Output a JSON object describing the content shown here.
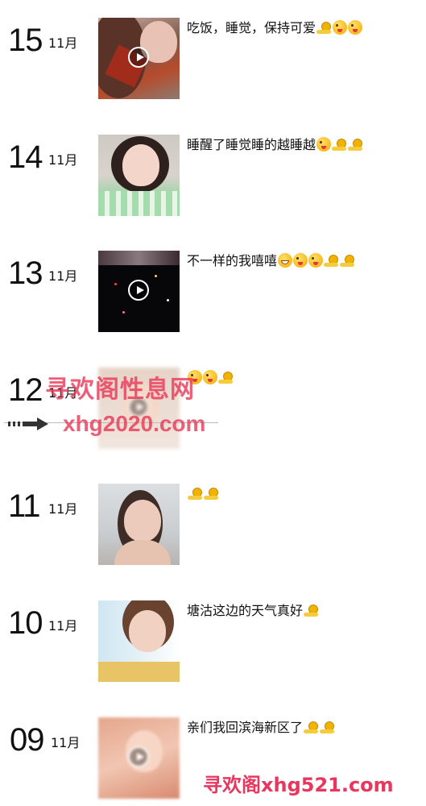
{
  "entries": [
    {
      "day": "15",
      "month": "11月",
      "caption": "吃饭，睡觉，保持可爱",
      "emojis": [
        "snail",
        "wink",
        "wink"
      ],
      "video": true
    },
    {
      "day": "14",
      "month": "11月",
      "caption": "睡醒了睡觉睡的越睡越",
      "emojis": [
        "wink",
        "snail",
        "snail"
      ],
      "video": false
    },
    {
      "day": "13",
      "month": "11月",
      "caption": "不一样的我嘻嘻",
      "emojis": [
        "grin",
        "wink",
        "wink",
        "snail",
        "snail"
      ],
      "video": true
    },
    {
      "day": "12",
      "month": "11月",
      "caption": "",
      "emojis": [
        "wink",
        "wink",
        "snail"
      ],
      "video": true
    },
    {
      "day": "11",
      "month": "11月",
      "caption": "",
      "emojis": [
        "snail",
        "snail"
      ],
      "video": false
    },
    {
      "day": "10",
      "month": "11月",
      "caption": "塘沽这边的天气真好",
      "emojis": [
        "snail"
      ],
      "video": false
    },
    {
      "day": "09",
      "month": "11月",
      "caption": "亲们我回滨海新区了",
      "emojis": [
        "snail",
        "snail"
      ],
      "video": true
    }
  ],
  "watermark": {
    "line1": "寻欢阁性息网",
    "line2": "xhg2020.com",
    "footer": "寻欢阁xhg521.com"
  }
}
